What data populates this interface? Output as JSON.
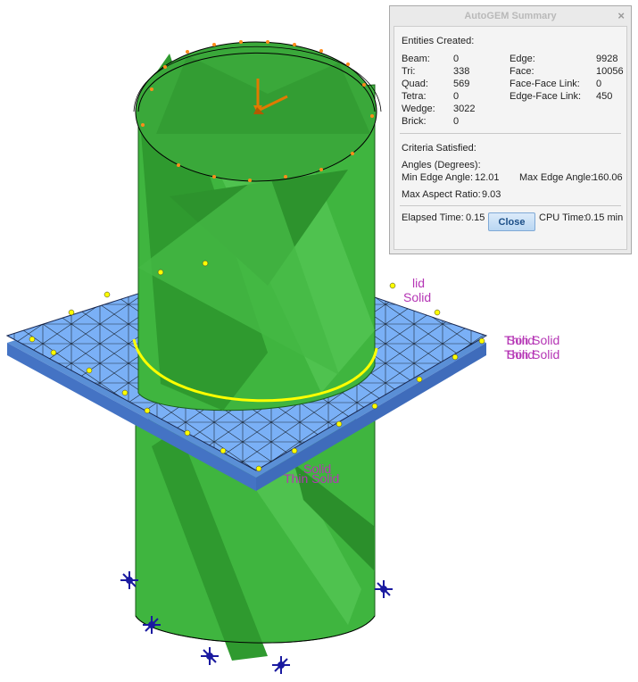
{
  "dialog": {
    "title": "AutoGEM Summary",
    "close_glyph": "×",
    "entities_heading": "Entities Created:",
    "left_stats": [
      {
        "label": "Beam:",
        "value": "0"
      },
      {
        "label": "Tri:",
        "value": "338"
      },
      {
        "label": "Quad:",
        "value": "569"
      },
      {
        "label": "Tetra:",
        "value": "0"
      },
      {
        "label": "Wedge:",
        "value": "3022"
      },
      {
        "label": "Brick:",
        "value": "0"
      }
    ],
    "right_stats": [
      {
        "label": "Edge:",
        "value": "9928"
      },
      {
        "label": "Face:",
        "value": "10056"
      },
      {
        "label": "Face-Face Link:",
        "value": "0"
      },
      {
        "label": "Edge-Face Link:",
        "value": "450"
      }
    ],
    "criteria_heading": "Criteria Satisfied:",
    "angles_heading": "Angles (Degrees):",
    "min_edge_label": "Min Edge Angle:",
    "min_edge_value": "12.01",
    "max_edge_label": "Max Edge Angle:",
    "max_edge_value": "160.06",
    "aspect_label": "Max Aspect Ratio:",
    "aspect_value": "9.03",
    "elapsed_label": "Elapsed Time:",
    "elapsed_value": "0.15 min",
    "cpu_label": "CPU Time:",
    "cpu_value": "0.15 min",
    "close_button": "Close"
  },
  "viewport": {
    "labels": {
      "right_top_a": "Thin Solid",
      "right_top_b": "Solid",
      "right_bottom_a": "Thin Solid",
      "right_bottom_b": "Solid",
      "front_a": "Solid",
      "front_b": "Thin Solid",
      "back": "lid",
      "side": "Solid"
    },
    "colors": {
      "cylinder": "#3cb33c",
      "plate": "#6aa6f0",
      "mesh_nodes": "#ffff00",
      "constraints": "#1a1aa0",
      "load_arrow": "#e07a00",
      "annotation_text": "#b535b5"
    }
  }
}
